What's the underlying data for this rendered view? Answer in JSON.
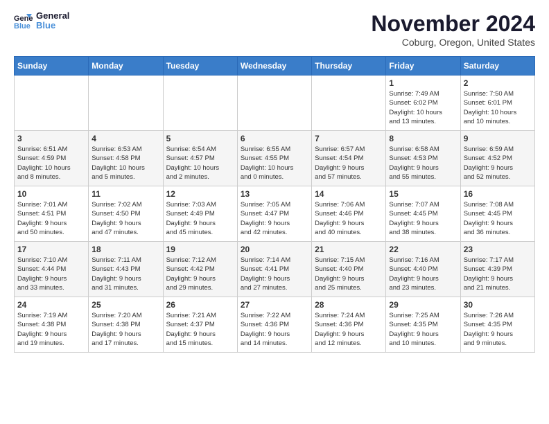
{
  "logo": {
    "text_general": "General",
    "text_blue": "Blue"
  },
  "header": {
    "month_title": "November 2024",
    "subtitle": "Coburg, Oregon, United States"
  },
  "weekdays": [
    "Sunday",
    "Monday",
    "Tuesday",
    "Wednesday",
    "Thursday",
    "Friday",
    "Saturday"
  ],
  "weeks": [
    [
      {
        "day": "",
        "info": ""
      },
      {
        "day": "",
        "info": ""
      },
      {
        "day": "",
        "info": ""
      },
      {
        "day": "",
        "info": ""
      },
      {
        "day": "",
        "info": ""
      },
      {
        "day": "1",
        "info": "Sunrise: 7:49 AM\nSunset: 6:02 PM\nDaylight: 10 hours\nand 13 minutes."
      },
      {
        "day": "2",
        "info": "Sunrise: 7:50 AM\nSunset: 6:01 PM\nDaylight: 10 hours\nand 10 minutes."
      }
    ],
    [
      {
        "day": "3",
        "info": "Sunrise: 6:51 AM\nSunset: 4:59 PM\nDaylight: 10 hours\nand 8 minutes."
      },
      {
        "day": "4",
        "info": "Sunrise: 6:53 AM\nSunset: 4:58 PM\nDaylight: 10 hours\nand 5 minutes."
      },
      {
        "day": "5",
        "info": "Sunrise: 6:54 AM\nSunset: 4:57 PM\nDaylight: 10 hours\nand 2 minutes."
      },
      {
        "day": "6",
        "info": "Sunrise: 6:55 AM\nSunset: 4:55 PM\nDaylight: 10 hours\nand 0 minutes."
      },
      {
        "day": "7",
        "info": "Sunrise: 6:57 AM\nSunset: 4:54 PM\nDaylight: 9 hours\nand 57 minutes."
      },
      {
        "day": "8",
        "info": "Sunrise: 6:58 AM\nSunset: 4:53 PM\nDaylight: 9 hours\nand 55 minutes."
      },
      {
        "day": "9",
        "info": "Sunrise: 6:59 AM\nSunset: 4:52 PM\nDaylight: 9 hours\nand 52 minutes."
      }
    ],
    [
      {
        "day": "10",
        "info": "Sunrise: 7:01 AM\nSunset: 4:51 PM\nDaylight: 9 hours\nand 50 minutes."
      },
      {
        "day": "11",
        "info": "Sunrise: 7:02 AM\nSunset: 4:50 PM\nDaylight: 9 hours\nand 47 minutes."
      },
      {
        "day": "12",
        "info": "Sunrise: 7:03 AM\nSunset: 4:49 PM\nDaylight: 9 hours\nand 45 minutes."
      },
      {
        "day": "13",
        "info": "Sunrise: 7:05 AM\nSunset: 4:47 PM\nDaylight: 9 hours\nand 42 minutes."
      },
      {
        "day": "14",
        "info": "Sunrise: 7:06 AM\nSunset: 4:46 PM\nDaylight: 9 hours\nand 40 minutes."
      },
      {
        "day": "15",
        "info": "Sunrise: 7:07 AM\nSunset: 4:45 PM\nDaylight: 9 hours\nand 38 minutes."
      },
      {
        "day": "16",
        "info": "Sunrise: 7:08 AM\nSunset: 4:45 PM\nDaylight: 9 hours\nand 36 minutes."
      }
    ],
    [
      {
        "day": "17",
        "info": "Sunrise: 7:10 AM\nSunset: 4:44 PM\nDaylight: 9 hours\nand 33 minutes."
      },
      {
        "day": "18",
        "info": "Sunrise: 7:11 AM\nSunset: 4:43 PM\nDaylight: 9 hours\nand 31 minutes."
      },
      {
        "day": "19",
        "info": "Sunrise: 7:12 AM\nSunset: 4:42 PM\nDaylight: 9 hours\nand 29 minutes."
      },
      {
        "day": "20",
        "info": "Sunrise: 7:14 AM\nSunset: 4:41 PM\nDaylight: 9 hours\nand 27 minutes."
      },
      {
        "day": "21",
        "info": "Sunrise: 7:15 AM\nSunset: 4:40 PM\nDaylight: 9 hours\nand 25 minutes."
      },
      {
        "day": "22",
        "info": "Sunrise: 7:16 AM\nSunset: 4:40 PM\nDaylight: 9 hours\nand 23 minutes."
      },
      {
        "day": "23",
        "info": "Sunrise: 7:17 AM\nSunset: 4:39 PM\nDaylight: 9 hours\nand 21 minutes."
      }
    ],
    [
      {
        "day": "24",
        "info": "Sunrise: 7:19 AM\nSunset: 4:38 PM\nDaylight: 9 hours\nand 19 minutes."
      },
      {
        "day": "25",
        "info": "Sunrise: 7:20 AM\nSunset: 4:38 PM\nDaylight: 9 hours\nand 17 minutes."
      },
      {
        "day": "26",
        "info": "Sunrise: 7:21 AM\nSunset: 4:37 PM\nDaylight: 9 hours\nand 15 minutes."
      },
      {
        "day": "27",
        "info": "Sunrise: 7:22 AM\nSunset: 4:36 PM\nDaylight: 9 hours\nand 14 minutes."
      },
      {
        "day": "28",
        "info": "Sunrise: 7:24 AM\nSunset: 4:36 PM\nDaylight: 9 hours\nand 12 minutes."
      },
      {
        "day": "29",
        "info": "Sunrise: 7:25 AM\nSunset: 4:35 PM\nDaylight: 9 hours\nand 10 minutes."
      },
      {
        "day": "30",
        "info": "Sunrise: 7:26 AM\nSunset: 4:35 PM\nDaylight: 9 hours\nand 9 minutes."
      }
    ]
  ]
}
